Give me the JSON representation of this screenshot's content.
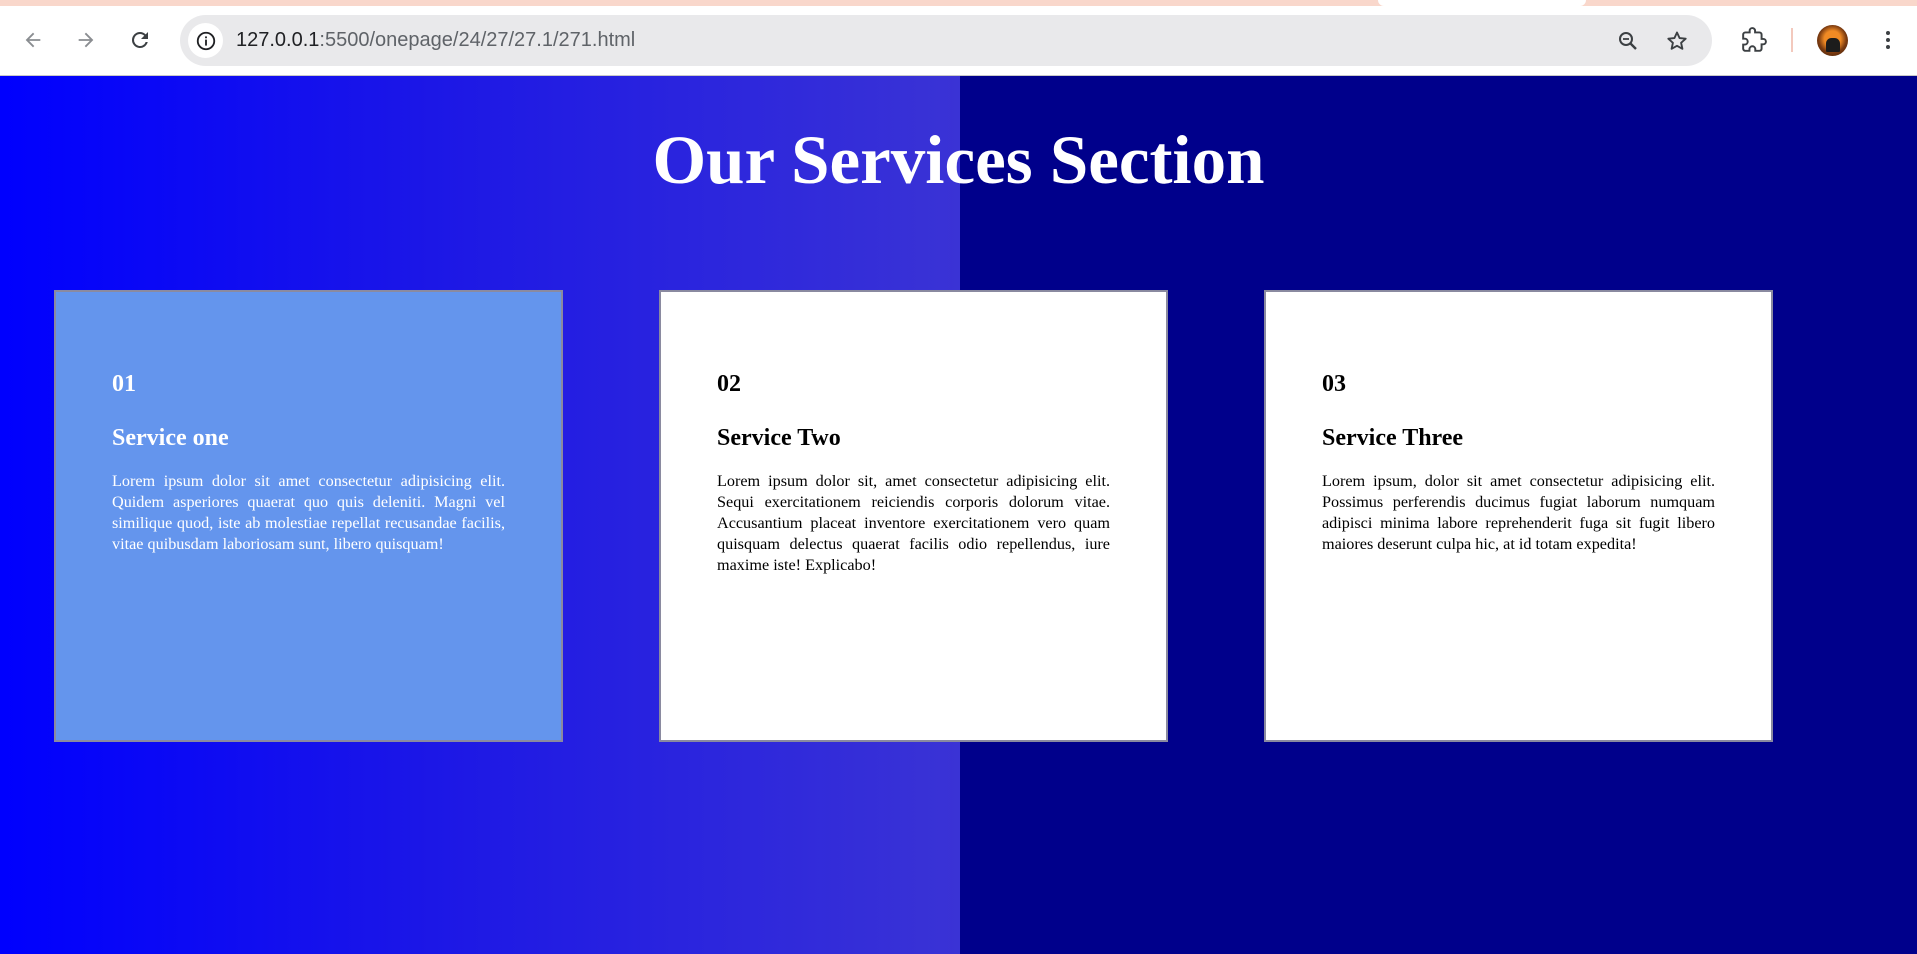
{
  "browser": {
    "url_host": "127.0.0.1",
    "url_rest": ":5500/onepage/24/27/27.1/271.html",
    "icons": {
      "back": "arrow-left-icon",
      "forward": "arrow-right-icon",
      "reload": "reload-icon",
      "site_info": "info-icon",
      "zoom": "zoom-icon",
      "bookmark": "star-icon",
      "extensions": "puzzle-icon",
      "menu": "kebab-menu-icon"
    }
  },
  "page": {
    "colors": {
      "background_dark": "#00008b",
      "gradient_start": "#0000fe",
      "gradient_end": "#3a33d5",
      "highlight_card": "#6495ed",
      "card": "#ffffff"
    },
    "title": "Our Services Section",
    "services": [
      {
        "number": "01",
        "title": "Service one",
        "description": "Lorem ipsum dolor sit amet consectetur adipisicing elit. Quidem asperiores quaerat quo quis deleniti. Magni vel similique quod, iste ab molestiae repellat recusandae facilis, vitae quibusdam laboriosam sunt, libero quisquam!",
        "highlighted": true
      },
      {
        "number": "02",
        "title": "Service Two",
        "description": "Lorem ipsum dolor sit, amet consectetur adipisicing elit. Sequi exercitationem reiciendis corporis dolorum vitae. Accusantium placeat inventore exercitationem vero quam quisquam delectus quaerat facilis odio repellendus, iure maxime iste! Explicabo!",
        "highlighted": false
      },
      {
        "number": "03",
        "title": "Service Three",
        "description": "Lorem ipsum, dolor sit amet consectetur adipisicing elit. Possimus perferendis ducimus fugiat laborum numquam adipisci minima labore reprehenderit fuga sit fugit libero maiores deserunt culpa hic, at id totam expedita!",
        "highlighted": false
      }
    ]
  }
}
